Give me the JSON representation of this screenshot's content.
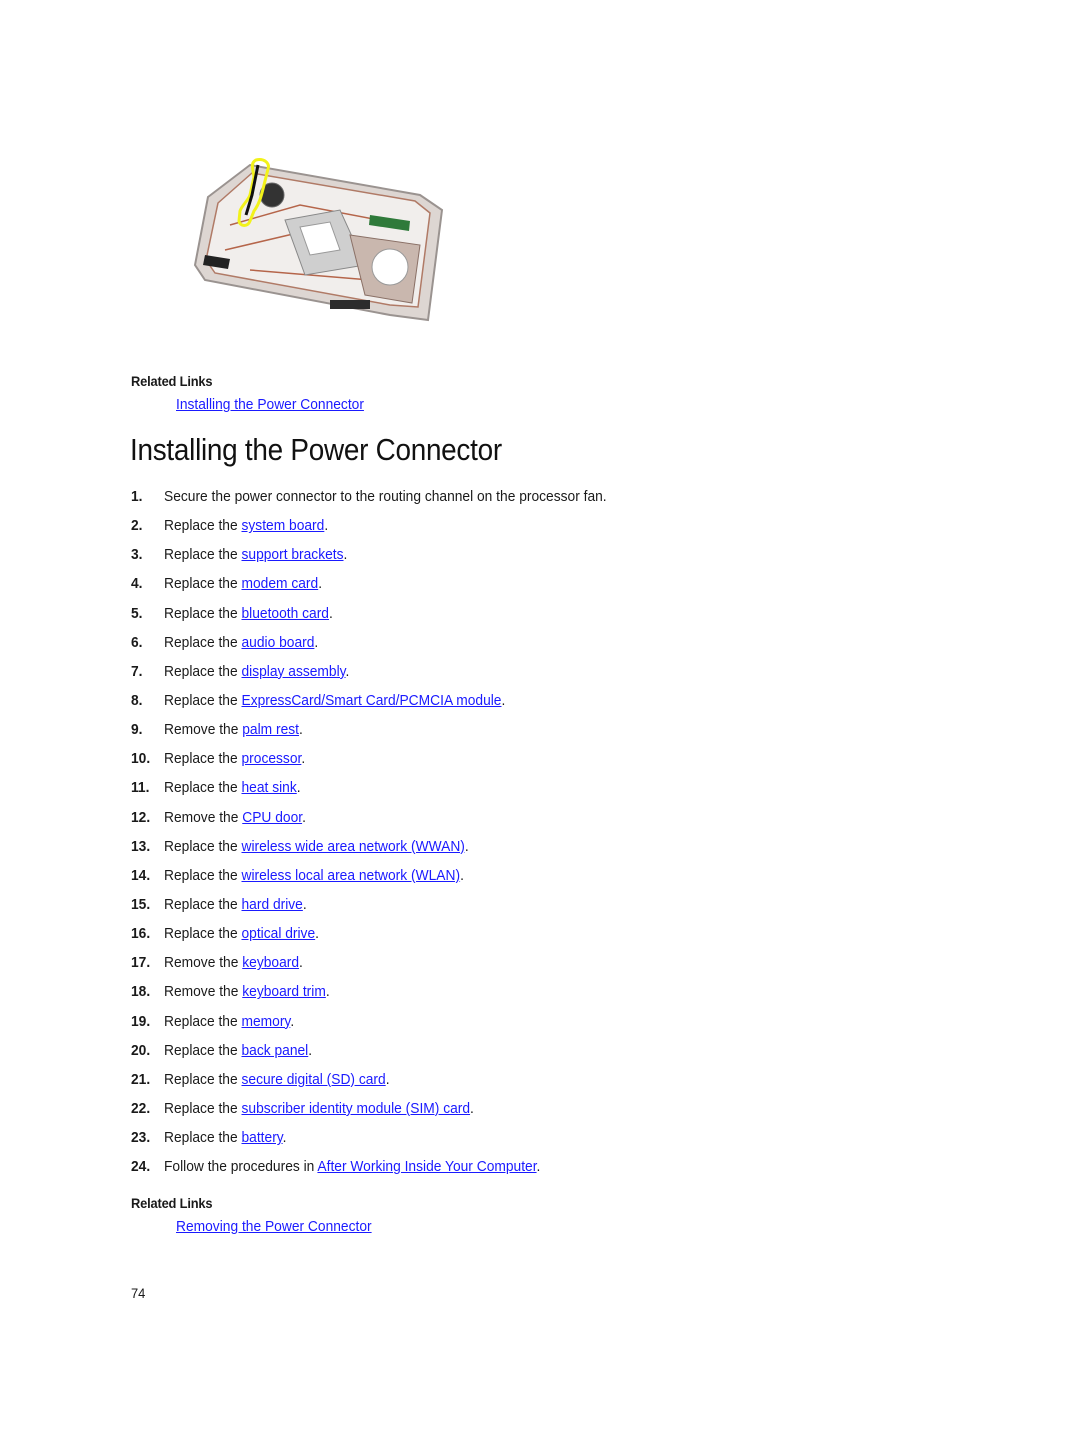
{
  "figure": {
    "alt": "Laptop base with power connector routed along processor fan, highlighted in yellow",
    "highlight_color": "#f2f21a"
  },
  "related_top": {
    "heading": "Related Links",
    "link": "Installing the Power Connector"
  },
  "title": "Installing the Power Connector",
  "steps": [
    {
      "num": "1.",
      "pre": "Secure the power connector to the routing channel on the processor fan.",
      "link": "",
      "post": ""
    },
    {
      "num": "2.",
      "pre": "Replace the ",
      "link": "system board",
      "post": "."
    },
    {
      "num": "3.",
      "pre": "Replace the ",
      "link": "support brackets",
      "post": "."
    },
    {
      "num": "4.",
      "pre": "Replace the ",
      "link": "modem card",
      "post": "."
    },
    {
      "num": "5.",
      "pre": "Replace the ",
      "link": "bluetooth card",
      "post": "."
    },
    {
      "num": "6.",
      "pre": "Replace the ",
      "link": "audio board",
      "post": "."
    },
    {
      "num": "7.",
      "pre": "Replace the ",
      "link": "display assembly",
      "post": "."
    },
    {
      "num": "8.",
      "pre": "Replace the ",
      "link": "ExpressCard/Smart Card/PCMCIA module",
      "post": "."
    },
    {
      "num": "9.",
      "pre": "Remove the ",
      "link": "palm rest",
      "post": "."
    },
    {
      "num": "10.",
      "pre": "Replace the ",
      "link": "processor",
      "post": "."
    },
    {
      "num": "11.",
      "pre": "Replace the ",
      "link": "heat sink",
      "post": "."
    },
    {
      "num": "12.",
      "pre": "Remove the ",
      "link": "CPU door",
      "post": "."
    },
    {
      "num": "13.",
      "pre": "Replace the ",
      "link": "wireless wide area network (WWAN)",
      "post": "."
    },
    {
      "num": "14.",
      "pre": "Replace the ",
      "link": "wireless local area network (WLAN)",
      "post": "."
    },
    {
      "num": "15.",
      "pre": "Replace the ",
      "link": "hard drive",
      "post": "."
    },
    {
      "num": "16.",
      "pre": "Replace the ",
      "link": "optical drive",
      "post": "."
    },
    {
      "num": "17.",
      "pre": "Remove the ",
      "link": "keyboard",
      "post": "."
    },
    {
      "num": "18.",
      "pre": "Remove the ",
      "link": "keyboard trim",
      "post": "."
    },
    {
      "num": "19.",
      "pre": "Replace the ",
      "link": "memory",
      "post": "."
    },
    {
      "num": "20.",
      "pre": "Replace the ",
      "link": "back panel",
      "post": "."
    },
    {
      "num": "21.",
      "pre": "Replace the ",
      "link": "secure digital (SD) card",
      "post": "."
    },
    {
      "num": "22.",
      "pre": "Replace the ",
      "link": "subscriber identity module (SIM) card",
      "post": "."
    },
    {
      "num": "23.",
      "pre": "Replace the ",
      "link": "battery",
      "post": "."
    },
    {
      "num": "24.",
      "pre": "Follow the procedures in ",
      "link": "After Working Inside Your Computer",
      "post": "."
    }
  ],
  "related_bottom": {
    "heading": "Related Links",
    "link": "Removing the Power Connector"
  },
  "page_number": "74"
}
